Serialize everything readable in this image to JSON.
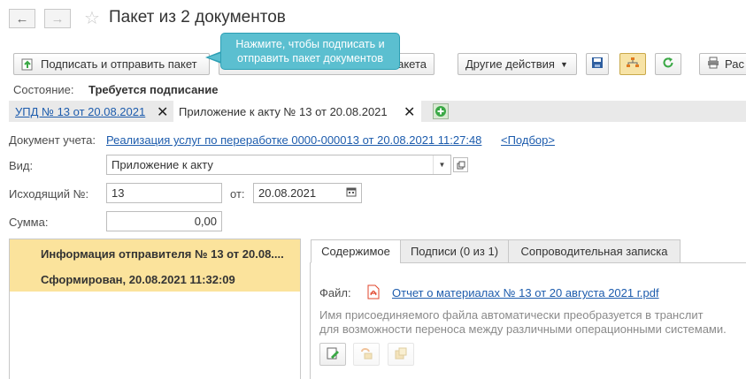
{
  "window": {
    "title": "Пакет из 2 документов",
    "back_icon": "←",
    "forward_icon": "→",
    "star_icon": "☆"
  },
  "toolbar": {
    "sign_send_label": "Подписать и отправить пакет",
    "second_label_visible": "акета",
    "other_actions_label": "Другие действия",
    "print_label": "Рас"
  },
  "tooltip": {
    "line1": "Нажмите, чтобы подписать и",
    "line2": "отправить пакет документов"
  },
  "state": {
    "label": "Состояние:",
    "value": "Требуется подписание"
  },
  "doc_tabs": [
    {
      "label": "УПД № 13 от 20.08.2021",
      "is_link": true
    },
    {
      "label": "Приложение к акту № 13 от 20.08.2021",
      "is_link": false
    }
  ],
  "form": {
    "account_doc_label": "Документ учета:",
    "account_doc_value": "Реализация услуг по переработке 0000-000013 от 20.08.2021 11:27:48",
    "pick_link": "<Подбор>",
    "kind_label": "Вид:",
    "kind_value": "Приложение к акту",
    "outgoing_label": "Исходящий №:",
    "outgoing_value": "13",
    "from_label": "от:",
    "from_value": "20.08.2021",
    "sum_label": "Сумма:",
    "sum_value": "0,00"
  },
  "left_list": {
    "line1": "Информация отправителя № 13 от 20.08....",
    "line2": "Сформирован, 20.08.2021 11:32:09"
  },
  "right_tabs": [
    {
      "label": "Содержимое",
      "active": true
    },
    {
      "label": "Подписи (0 из 1)",
      "active": false
    },
    {
      "label": "Сопроводительная записка",
      "active": false
    }
  ],
  "content": {
    "file_label": "Файл:",
    "file_name": "Отчет о материалах № 13 от 20 августа 2021 г.pdf",
    "hint_line1": "Имя присоединяемого файла автоматически преобразуется в транслит",
    "hint_line2": "для возможности переноса между различными операционными системами."
  },
  "colors": {
    "link": "#1d5cad",
    "selected_row": "#fbe39c",
    "tooltip": "#5bbfd0",
    "pdf_red": "#e0452b",
    "green_add": "#3aa845"
  }
}
